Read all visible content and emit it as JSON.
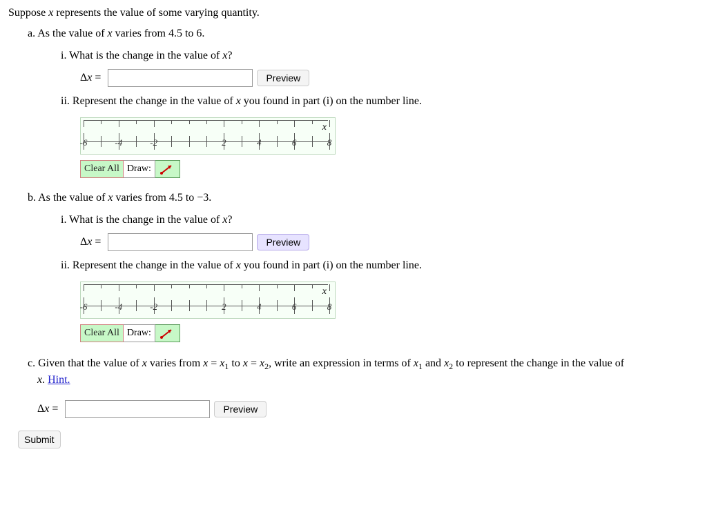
{
  "intro": "Suppose x represents the value of some varying quantity.",
  "parts": {
    "a": {
      "label": "a.",
      "text": "As the value of x varies from 4.5 to 6.",
      "i_label": "i.",
      "i_text": "What is the change in the value of x?",
      "delta": "Δx =",
      "preview": "Preview",
      "ii_label": "ii.",
      "ii_text": "Represent the change in the value of x you found in part (i) on the number line.",
      "axis_var": "x",
      "ticks": [
        "-6",
        "-4",
        "-2",
        "",
        "2",
        "4",
        "6",
        "8"
      ],
      "clear": "Clear All",
      "draw": "Draw:"
    },
    "b": {
      "label": "b.",
      "text": "As the value of x varies from 4.5 to −3.",
      "i_label": "i.",
      "i_text": "What is the change in the value of x?",
      "delta": "Δx =",
      "preview": "Preview",
      "ii_label": "ii.",
      "ii_text": "Represent the change in the value of x you found in part (i) on the number line.",
      "axis_var": "x",
      "ticks": [
        "-6",
        "-4",
        "-2",
        "",
        "2",
        "4",
        "6",
        "8"
      ],
      "clear": "Clear All",
      "draw": "Draw:"
    },
    "c": {
      "label": "c.",
      "text_prefix": "Given that the value of x varies from x = x",
      "sub1": "1",
      "text_mid": " to x = x",
      "sub2": "2",
      "text_mid2": ", write an expression in terms of x",
      "text_mid3": " and x",
      "text_suffix": " to represent the change in the value of x.",
      "hint_prefix": " ",
      "hint": "Hint.",
      "x_label": "x.",
      "delta": "Δx =",
      "preview": "Preview"
    }
  },
  "submit": "Submit",
  "chart_data": [
    {
      "type": "numberline",
      "x": [
        -6,
        -5,
        -4,
        -3,
        -2,
        -1,
        0,
        1,
        2,
        3,
        4,
        5,
        6,
        7,
        8
      ],
      "labeled": [
        -6,
        -4,
        -2,
        2,
        4,
        6,
        8
      ],
      "xlim": [
        -6,
        8
      ],
      "axis_label": "x"
    },
    {
      "type": "numberline",
      "x": [
        -6,
        -5,
        -4,
        -3,
        -2,
        -1,
        0,
        1,
        2,
        3,
        4,
        5,
        6,
        7,
        8
      ],
      "labeled": [
        -6,
        -4,
        -2,
        2,
        4,
        6,
        8
      ],
      "xlim": [
        -6,
        8
      ],
      "axis_label": "x"
    }
  ]
}
